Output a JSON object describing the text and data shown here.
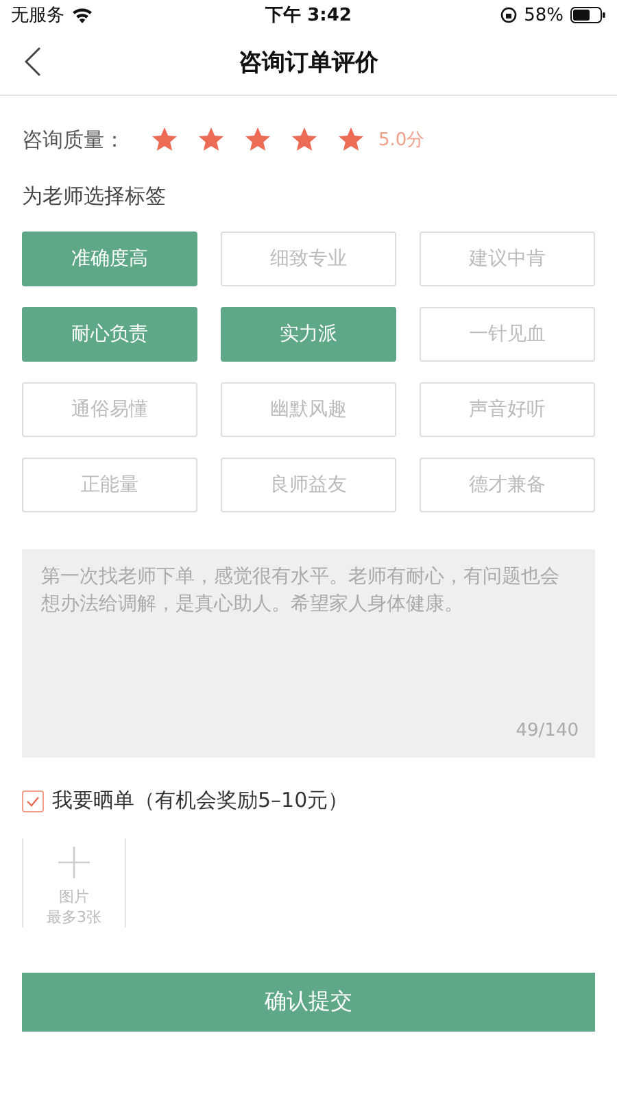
{
  "status_bar": {
    "carrier": "无服务",
    "time": "下午 3:42",
    "battery": "58%"
  },
  "nav": {
    "title": "咨询订单评价"
  },
  "ratings": [
    {
      "label": "咨询质量：",
      "stars": 5,
      "score": "5.0分"
    }
  ],
  "tags_title": "为老师选择标签",
  "tags": [
    {
      "label": "准确度高",
      "selected": true
    },
    {
      "label": "细致专业",
      "selected": false
    },
    {
      "label": "建议中肯",
      "selected": false
    },
    {
      "label": "耐心负责",
      "selected": true
    },
    {
      "label": "实力派",
      "selected": true
    },
    {
      "label": "一针见血",
      "selected": false
    },
    {
      "label": "通俗易懂",
      "selected": false
    },
    {
      "label": "幽默风趣",
      "selected": false
    },
    {
      "label": "声音好听",
      "selected": false
    },
    {
      "label": "正能量",
      "selected": false
    },
    {
      "label": "良师益友",
      "selected": false
    },
    {
      "label": "德才兼备",
      "selected": false
    }
  ],
  "comment": {
    "value": "第一次找老师下单，感觉很有水平。老师有耐心，有问题也会想办法给调解，是真心助人。希望家人身体健康。",
    "count": "49/140"
  },
  "share": {
    "label": "我要晒单（有机会奖励5–10元）",
    "checked": true
  },
  "upload": {
    "label": "图片",
    "hint": "最多3张"
  },
  "submit": "确认提交"
}
